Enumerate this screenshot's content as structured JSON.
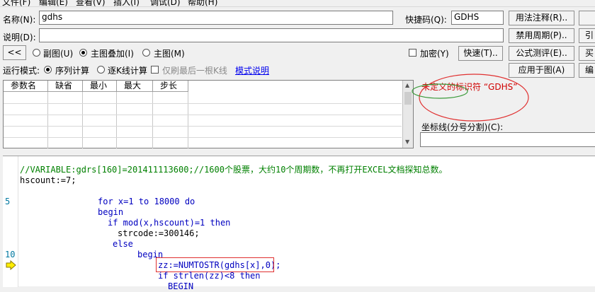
{
  "menu": [
    {
      "label": "文件(F)"
    },
    {
      "label": "编辑(E)"
    },
    {
      "label": "查看(V)"
    },
    {
      "label": "插入(I)"
    },
    {
      "label": "调试(D)"
    },
    {
      "label": "帮助(H)"
    }
  ],
  "form": {
    "name_label": "名称(N):",
    "name_value": "gdhs",
    "shortcut_label": "快捷码(Q):",
    "shortcut_value": "GDHS",
    "desc_label": "说明(D):",
    "desc_value": "",
    "back_button": "<<",
    "radio_sub": "副图(U)",
    "radio_overlay": "主图叠加(I)",
    "radio_main": "主图(M)",
    "encrypt_label": "加密(Y)",
    "speed_button": "快速(T)..",
    "run_mode_label": "运行模式:",
    "radio_seq": "序列计算",
    "radio_tick": "逐K线计算",
    "only_last_label": "仅刷最后一根K线",
    "mode_help_link": "模式说明"
  },
  "right_buttons": {
    "usage_note": "用法注释(R)..",
    "disable_period": "禁用周期(P)..",
    "formula_test": "公式测评(E)..",
    "apply_to_chart": "应用于图(A)",
    "side_1": "引",
    "side_2": "买",
    "side_3": "编"
  },
  "params_table": {
    "headers": [
      "参数名",
      "缺省",
      "最小",
      "最大",
      "步长"
    ]
  },
  "message": {
    "error_text": "未定义的标识符 “GDHS”",
    "coord_label": "坐标线(分号分割)(C):",
    "coord_value": ""
  },
  "editor": {
    "line_numbers": [
      "5",
      "10"
    ],
    "lines": [
      "//VARIABLE:gdrs[160]=201411113600;//1600个股票，大约10个周期数，不再打开EXCEL文档探知总数。",
      "hscount:=7;",
      "for x=1 to 18000 do",
      "begin",
      "if mod(x,hscount)=1 then",
      "strcode:=300146;",
      "else",
      "begin",
      "zz:=NUMTOSTR(gdhs[x],0);",
      "if strlen(zz)<8 then",
      "BEGIN"
    ],
    "annotation_color": "#e03030",
    "error_color": "#d00000"
  }
}
